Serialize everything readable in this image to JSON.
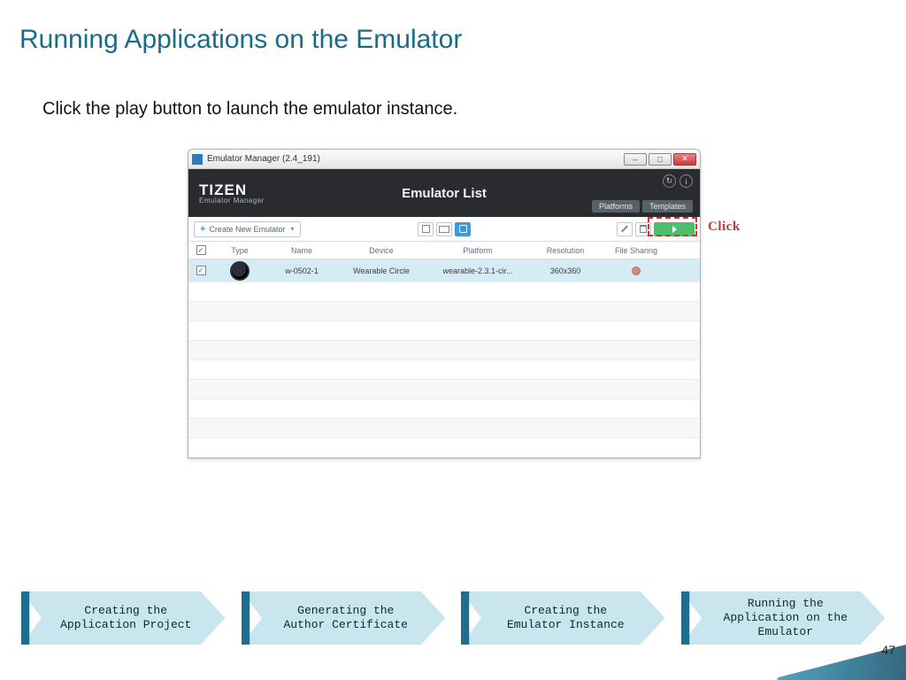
{
  "slide": {
    "title": "Running Applications on the Emulator",
    "instruction": "Click the play button to launch the emulator instance.",
    "page_number": "47"
  },
  "emulator_window": {
    "title": "Emulator Manager (2.4_191)",
    "brand": "TIZEN",
    "brand_sub": "Emulator Manager",
    "list_title": "Emulator List",
    "header_tabs": {
      "platforms": "Platforms",
      "templates": "Templates"
    },
    "toolbar": {
      "create_label": "Create New Emulator",
      "plus": "+",
      "dropdown_glyph": "▾"
    },
    "columns": {
      "type": "Type",
      "name": "Name",
      "device": "Device",
      "platform": "Platform",
      "resolution": "Resolution",
      "file_sharing": "File Sharing"
    },
    "row": {
      "checked": "✓",
      "name": "w-0502-1",
      "device": "Wearable Circle",
      "platform": "wearable-2.3.1-cir...",
      "resolution": "360x360"
    },
    "win_controls": {
      "min": "–",
      "max": "□",
      "close": "✕"
    },
    "hdr_icons": {
      "refresh": "↻",
      "info": "i"
    }
  },
  "callout": {
    "click": "Click"
  },
  "process": {
    "steps": [
      "Creating the\nApplication Project",
      "Generating the\nAuthor Certificate",
      "Creating the\nEmulator Instance",
      "Running the\nApplication on the\nEmulator"
    ]
  }
}
